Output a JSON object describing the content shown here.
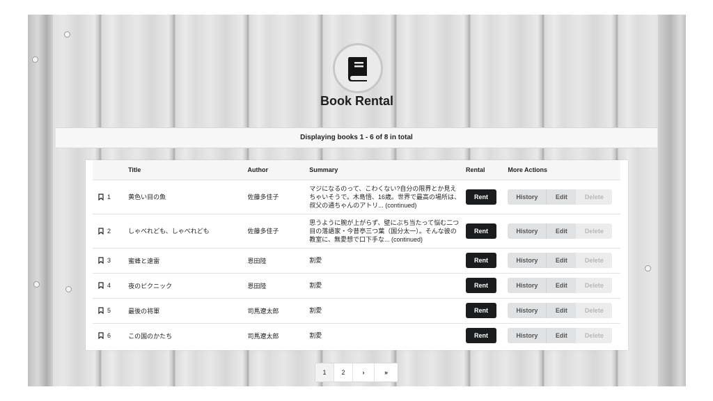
{
  "app": {
    "title": "Book Rental",
    "icon": "book-icon"
  },
  "info": {
    "text": "Displaying books 1 - 6 of 8 in total"
  },
  "table": {
    "headers": {
      "no": "",
      "title": "Title",
      "author": "Author",
      "summary": "Summary",
      "rental": "Rental",
      "actions": "More Actions"
    },
    "rows": [
      {
        "no": "1",
        "title": "黄色い目の魚",
        "author": "佐藤多佳子",
        "summary": "マジになるのって、こわくない?自分の限界とか見えちゃいそうで。木島悟、16歳。世界で最高の場所は、叔父の通ちゃんのアトリ... (continued)"
      },
      {
        "no": "2",
        "title": "しゃべれども、しゃべれども",
        "author": "佐藤多佳子",
        "summary": "思うように腕が上がらず、壁にぶち当たって悩む二つ目の落語家・今昔亭三つ葉（国分太一）。そんな彼の教室に、無愛想で口下手な... (continued)"
      },
      {
        "no": "3",
        "title": "蜜蜂と遠雷",
        "author": "恩田陸",
        "summary": "割愛"
      },
      {
        "no": "4",
        "title": "夜のピクニック",
        "author": "恩田陸",
        "summary": "割愛"
      },
      {
        "no": "5",
        "title": "最後の将軍",
        "author": "司馬遼太郎",
        "summary": "割愛"
      },
      {
        "no": "6",
        "title": "この国のかたち",
        "author": "司馬遼太郎",
        "summary": "割愛"
      }
    ],
    "buttons": {
      "rent": "Rent",
      "history": "History",
      "edit": "Edit",
      "delete": "Delete"
    }
  },
  "pagination": {
    "pages": [
      "1",
      "2"
    ],
    "next": "›",
    "last": "»"
  },
  "colors": {
    "primary_button": "#1b1c1d",
    "secondary_button": "#e0e1e2",
    "disabled_text": "#b8b8b8"
  }
}
